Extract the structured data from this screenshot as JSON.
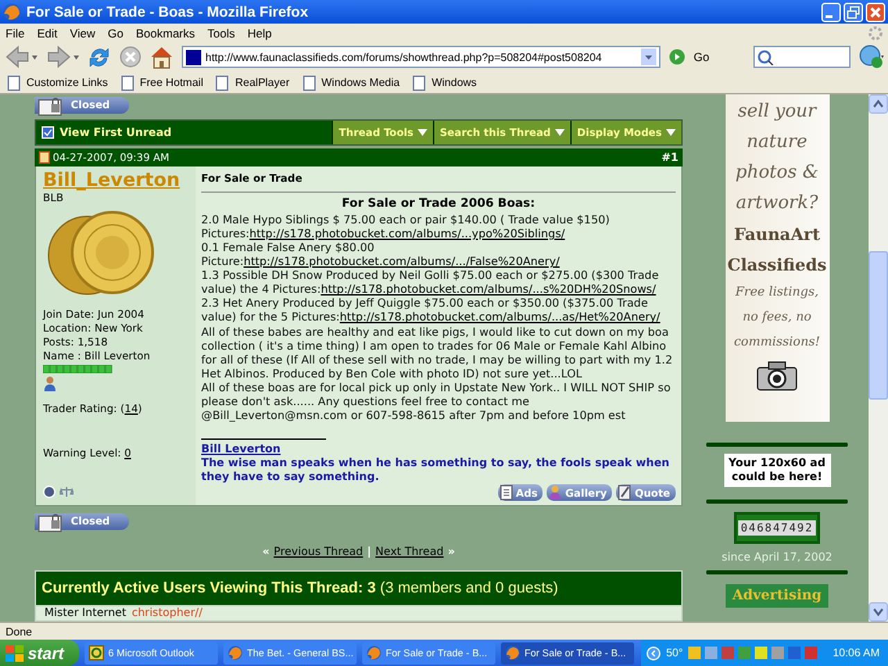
{
  "window": {
    "title": "For Sale or Trade - Boas - Mozilla Firefox"
  },
  "menu": [
    "File",
    "Edit",
    "View",
    "Go",
    "Bookmarks",
    "Tools",
    "Help"
  ],
  "toolbar": {
    "url": "http://www.faunaclassifieds.com/forums/showthread.php?p=508204#post508204",
    "go_label": "Go"
  },
  "bookmarks": [
    "Customize Links",
    "Free Hotmail",
    "RealPlayer",
    "Windows Media",
    "Windows"
  ],
  "thread": {
    "closed_label": "Closed",
    "view_first_unread": "View First Unread",
    "tools": [
      "Thread Tools",
      "Search this Thread",
      "Display Modes"
    ]
  },
  "post": {
    "date": "04-27-2007, 09:39 AM",
    "number": "#1",
    "user": {
      "name": "Bill_Leverton",
      "title": "BLB",
      "details": [
        "Join Date: Jun 2004",
        "Location: New York",
        "Posts: 1,518",
        "Name : Bill Leverton"
      ],
      "rating": [
        {
          "text": "Trader Rating: (",
          "kind": "plain"
        },
        {
          "text": "14",
          "kind": "link"
        },
        {
          "text": ")",
          "kind": "plain"
        }
      ],
      "warning": [
        {
          "text": "Warning Level: ",
          "kind": "plain"
        },
        {
          "text": "0",
          "kind": "link"
        }
      ]
    },
    "title": "For Sale or Trade",
    "heading": "For Sale or Trade 2006 Boas:",
    "paragraphs": [
      [
        {
          "text": "2.0 Male Hypo Siblings $ 75.00 each or pair $140.00 ( Trade value $150)",
          "kind": "plain"
        }
      ],
      [
        {
          "text": "Pictures:",
          "kind": "plain"
        },
        {
          "text": "http://s178.photobucket.com/albums/...ypo%20Siblings/",
          "kind": "link"
        }
      ],
      [
        {
          "text": "0.1 Female False Anery $80.00",
          "kind": "plain"
        }
      ],
      [
        {
          "text": "Picture:",
          "kind": "plain"
        },
        {
          "text": "http://s178.photobucket.com/albums/.../False%20Anery/",
          "kind": "link"
        }
      ],
      [
        {
          "text": "1.3 Possible DH Snow Produced by Neil Golli $75.00 each or $275.00 ($300 Trade value) the 4 Pictures:",
          "kind": "plain"
        },
        {
          "text": "http://s178.photobucket.com/albums/...s%20DH%20Snows/",
          "kind": "link"
        }
      ],
      [
        {
          "text": "2.3 Het Anery Produced by Jeff Quiggle $75.00 each or $350.00 ($375.00 Trade value) for the 5 Pictures:",
          "kind": "plain"
        },
        {
          "text": "http://s178.photobucket.com/albums/...as/Het%20Anery/",
          "kind": "link"
        }
      ],
      [
        {
          "text": "All of these babes are healthy and eat like pigs, I would like to cut down on my boa collection ( it's a time thing) I am open to trades for 06 Male or Female Kahl Albino for all of these (If All of these sell with no trade, I may be willing to part with my 1.2 Het Albinos. Produced by Ben Cole with photo ID) not sure yet...LOL",
          "kind": "plain"
        }
      ],
      [
        {
          "text": "All of these boas are for local pick up only in Upstate New York.. I WILL NOT SHIP so please don't ask...... Any questions feel free to contact me @Bill_Leverton@msn.com or 607-598-8615 after 7pm and before 10pm est",
          "kind": "plain"
        }
      ]
    ],
    "signature_name": "Bill Leverton",
    "signature": "The wise man speaks when he has something to say, the fools speak when they have to say something.",
    "buttons": [
      "Ads",
      "Gallery",
      "Quote"
    ]
  },
  "closed_bottom": "Closed",
  "thread_nav": [
    {
      "text": "«",
      "kind": "glyph"
    },
    {
      "text": "Previous Thread",
      "kind": "link"
    },
    {
      "text": "|",
      "kind": "glyph"
    },
    {
      "text": "Next Thread",
      "kind": "link"
    },
    {
      "text": "»",
      "kind": "glyph"
    }
  ],
  "active_users": {
    "title": "**Currently Active Users Viewing This Thread: 3** (3 members and 0 guests)",
    "viewers": [
      {
        "name": "Mister Internet",
        "color": "#000000"
      },
      {
        "name": "christopher//",
        "color": "#e0401c"
      }
    ]
  },
  "sidebar": {
    "ad_lines": [
      {
        "text": "sell your",
        "kind": "large"
      },
      {
        "text": "nature",
        "kind": "large"
      },
      {
        "text": "photos &",
        "kind": "large"
      },
      {
        "text": "artwork?",
        "kind": "large"
      },
      {
        "text": "FaunaArt",
        "kind": "bold"
      },
      {
        "text": "Classifieds",
        "kind": "bold"
      },
      {
        "text": "Free listings,",
        "kind": "small"
      },
      {
        "text": "no fees, no",
        "kind": "small"
      },
      {
        "text": "commissions!",
        "kind": "small"
      }
    ],
    "ad_slot": "Your 120x60 ad could be here!",
    "counter": "046847492",
    "since": "since April 17, 2002",
    "advertising": "Advertising"
  },
  "status_bar": "Done",
  "taskbar": {
    "start": "start",
    "tasks": [
      {
        "label": "6 Microsoft Outlook",
        "kind": "mail",
        "selected": false
      },
      {
        "label": "The Bet. - General BS...",
        "kind": "browser",
        "selected": false
      },
      {
        "label": "For Sale or Trade - B...",
        "kind": "browser",
        "selected": false
      },
      {
        "label": "For Sale or Trade - B...",
        "kind": "browser",
        "selected": true
      }
    ],
    "temperature": "50°",
    "clock": "10:06 AM"
  }
}
